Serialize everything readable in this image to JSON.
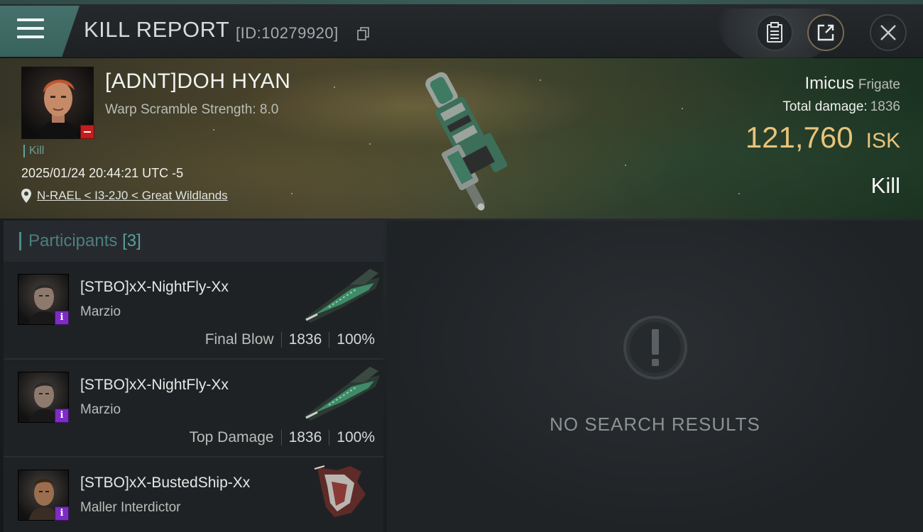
{
  "header": {
    "title": "KILL REPORT",
    "report_id": "[ID:10279920]",
    "icons": {
      "menu": "menu-icon",
      "copy": "copy-icon",
      "clipboard": "clipboard-icon",
      "share": "share-icon",
      "close": "close-icon"
    }
  },
  "victim": {
    "name": "[ADNT]DOH HYAN",
    "warp_scramble": "Warp Scramble Strength: 8.0",
    "tag": "Kill",
    "timestamp": "2025/01/24 20:44:21 UTC -5",
    "location": "N-RAEL < I3-2J0 < Great Wildlands",
    "ship_name": "Imicus",
    "ship_class": "Frigate",
    "total_damage_label": "Total damage:",
    "total_damage_value": "1836",
    "isk_value": "121,760",
    "isk_unit": "ISK",
    "result": "Kill"
  },
  "participants": {
    "title": "Participants",
    "count": "[3]",
    "rows": [
      {
        "name": "[STBO]xX-NightFly-Xx",
        "ship": "Marzio",
        "label": "Final Blow",
        "damage": "1836",
        "percent": "100%"
      },
      {
        "name": "[STBO]xX-NightFly-Xx",
        "ship": "Marzio",
        "label": "Top Damage",
        "damage": "1836",
        "percent": "100%"
      },
      {
        "name": "[STBO]xX-BustedShip-Xx",
        "ship": "Maller Interdictor"
      }
    ]
  },
  "results": {
    "empty_text": "NO SEARCH RESULTS"
  },
  "colors": {
    "accent_teal": "#4a8c89",
    "isk_gold": "#e9c37a",
    "badge_purple": "#7d2cc4",
    "badge_red": "#c31d1d"
  }
}
